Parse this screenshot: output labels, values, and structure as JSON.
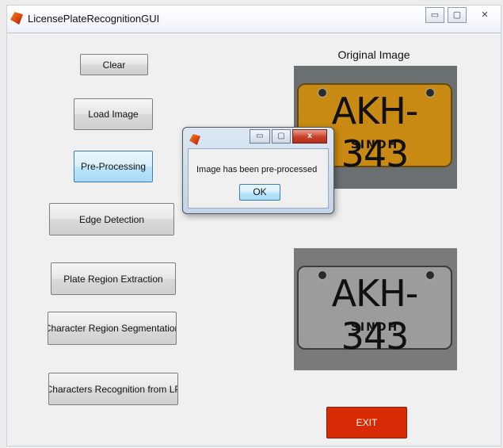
{
  "window": {
    "title": "LicensePlateRecognitionGUI",
    "controls": {
      "minimize": "▭",
      "maximize": "▢",
      "close": "✕"
    }
  },
  "buttons": {
    "clear": "Clear",
    "load_image": "Load Image",
    "pre_processing": "Pre-Processing",
    "edge_detection": "Edge Detection",
    "plate_region_extraction": "Plate Region Extraction",
    "character_region_segmentation": "Character Region Segmentation",
    "characters_recognition": "Characters Recognition from LP",
    "exit": "EXIT"
  },
  "images": {
    "original_label": "Original Image",
    "original_plate_text": "AKH-343",
    "original_plate_subtext": "SINDH",
    "processed_plate_text": "AKH-343",
    "processed_plate_subtext": "SINDH"
  },
  "dialog": {
    "message": "Image has been pre-processed",
    "ok_label": "OK",
    "controls": {
      "minimize": "▭",
      "maximize": "▢",
      "close": "x"
    }
  },
  "colors": {
    "exit_button": "#d72a05",
    "active_button": "#bee6fd",
    "plate_color": "#c88a12"
  },
  "icons": {
    "app_icon": "matlab-icon",
    "dialog_icon": "matlab-icon"
  }
}
